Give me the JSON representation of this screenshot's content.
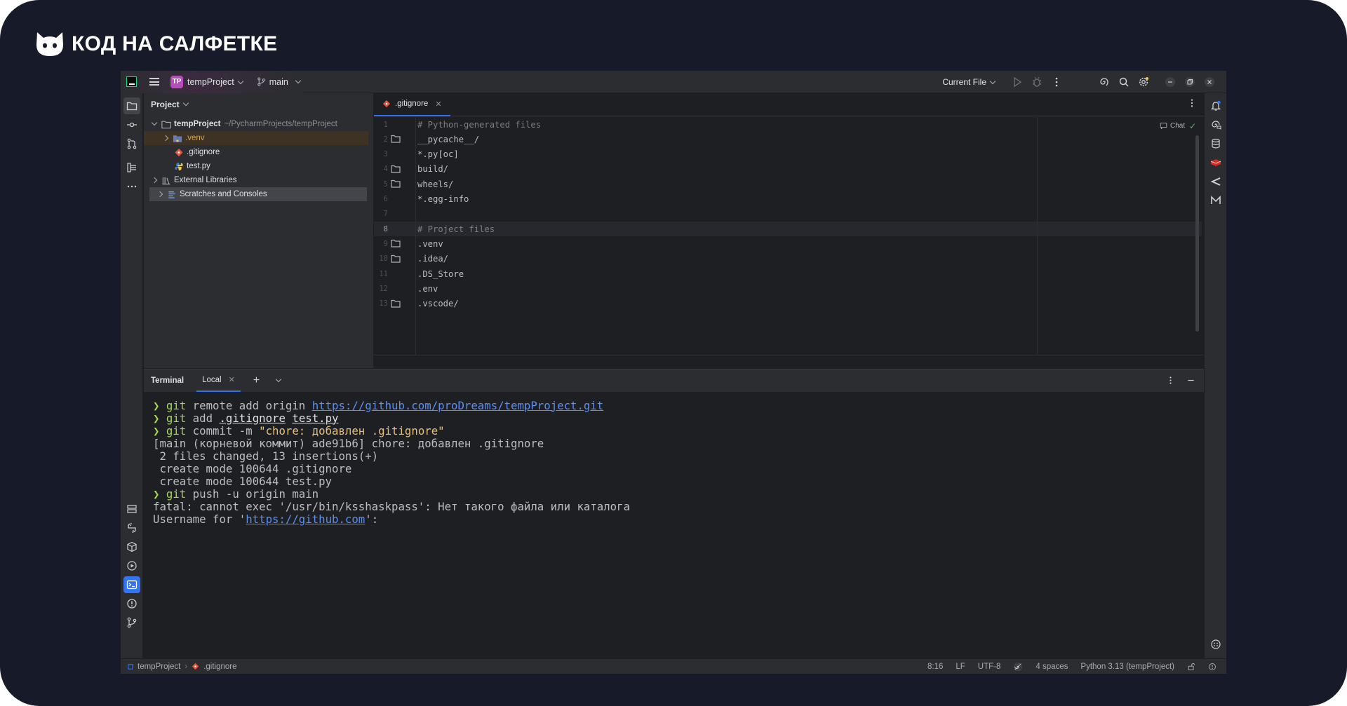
{
  "brand": {
    "name": "КОД НА САЛФЕТКЕ",
    "logo_icon": "cat-head-icon"
  },
  "titlebar": {
    "project_initials": "TP",
    "project_name": "tempProject",
    "branch": "main",
    "run_config": "Current File"
  },
  "project_panel": {
    "title": "Project",
    "tree": [
      {
        "label": "tempProject",
        "path": "~/PycharmProjects/tempProject",
        "icon": "folder-icon",
        "expanded": true
      },
      {
        "label": ".venv",
        "icon": "python-folder-icon"
      },
      {
        "label": ".gitignore",
        "icon": "git-file-icon"
      },
      {
        "label": "test.py",
        "icon": "python-file-icon"
      },
      {
        "label": "External Libraries",
        "icon": "library-icon"
      },
      {
        "label": "Scratches and Consoles",
        "icon": "scratches-icon"
      }
    ]
  },
  "editor": {
    "tab_label": ".gitignore",
    "chat_label": "Chat",
    "lines": [
      {
        "n": "1",
        "text": "# Python-generated files",
        "kind": "comment",
        "folder": false
      },
      {
        "n": "2",
        "text": "__pycache__/",
        "kind": "plain",
        "folder": true
      },
      {
        "n": "3",
        "text": "*.py[oc]",
        "kind": "plain",
        "folder": false
      },
      {
        "n": "4",
        "text": "build/",
        "kind": "plain",
        "folder": true
      },
      {
        "n": "5",
        "text": "wheels/",
        "kind": "plain",
        "folder": true
      },
      {
        "n": "6",
        "text": "*.egg-info",
        "kind": "plain",
        "folder": false
      },
      {
        "n": "7",
        "text": "",
        "kind": "plain",
        "folder": false
      },
      {
        "n": "8",
        "text": "# Project files",
        "kind": "comment",
        "folder": false
      },
      {
        "n": "9",
        "text": ".venv",
        "kind": "plain",
        "folder": true
      },
      {
        "n": "10",
        "text": ".idea/",
        "kind": "plain",
        "folder": true
      },
      {
        "n": "11",
        "text": ".DS_Store",
        "kind": "plain",
        "folder": false
      },
      {
        "n": "12",
        "text": ".env",
        "kind": "plain",
        "folder": false
      },
      {
        "n": "13",
        "text": ".vscode/",
        "kind": "plain",
        "folder": true
      }
    ]
  },
  "terminal": {
    "title": "Terminal",
    "tab_label": "Local",
    "prompt_symbol": "❯",
    "lines": [
      {
        "segments": [
          {
            "t": "❯ ",
            "c": "prompt"
          },
          {
            "t": "git",
            "c": "green"
          },
          {
            "t": " remote add origin ",
            "c": "plain"
          },
          {
            "t": "https://github.com/proDreams/tempProject.git",
            "c": "link"
          }
        ]
      },
      {
        "segments": [
          {
            "t": "❯ ",
            "c": "prompt"
          },
          {
            "t": "git",
            "c": "green"
          },
          {
            "t": " add ",
            "c": "plain"
          },
          {
            "t": ".gitignore",
            "c": "und"
          },
          {
            "t": " ",
            "c": "plain"
          },
          {
            "t": "test.py",
            "c": "und"
          }
        ]
      },
      {
        "segments": [
          {
            "t": "❯ ",
            "c": "prompt"
          },
          {
            "t": "git",
            "c": "green"
          },
          {
            "t": " commit -m ",
            "c": "plain"
          },
          {
            "t": "\"chore: добавлен .gitignore\"",
            "c": "str"
          }
        ]
      },
      {
        "segments": [
          {
            "t": "[main (корневой коммит) ade91b6] chore: добавлен .gitignore",
            "c": "plain"
          }
        ]
      },
      {
        "segments": [
          {
            "t": " 2 files changed, 13 insertions(+)",
            "c": "plain"
          }
        ]
      },
      {
        "segments": [
          {
            "t": " create mode 100644 .gitignore",
            "c": "plain"
          }
        ]
      },
      {
        "segments": [
          {
            "t": " create mode 100644 test.py",
            "c": "plain"
          }
        ]
      },
      {
        "segments": [
          {
            "t": "❯ ",
            "c": "prompt"
          },
          {
            "t": "git",
            "c": "green"
          },
          {
            "t": " push -u origin main",
            "c": "plain"
          }
        ]
      },
      {
        "segments": [
          {
            "t": "fatal: cannot exec '/usr/bin/ksshaskpass': Нет такого файла или каталога",
            "c": "plain"
          }
        ]
      },
      {
        "segments": [
          {
            "t": "Username for '",
            "c": "plain"
          },
          {
            "t": "https://github.com",
            "c": "link"
          },
          {
            "t": "':",
            "c": "plain"
          }
        ]
      }
    ]
  },
  "statusbar": {
    "project": "tempProject",
    "file": ".gitignore",
    "position": "8:16",
    "line_sep": "LF",
    "encoding": "UTF-8",
    "indent": "4 spaces",
    "interpreter": "Python 3.13 (tempProject)"
  },
  "colors": {
    "accent": "#3574f0",
    "bg": "#1e1f22",
    "panel": "#2b2d30",
    "frame": "#171a29"
  }
}
